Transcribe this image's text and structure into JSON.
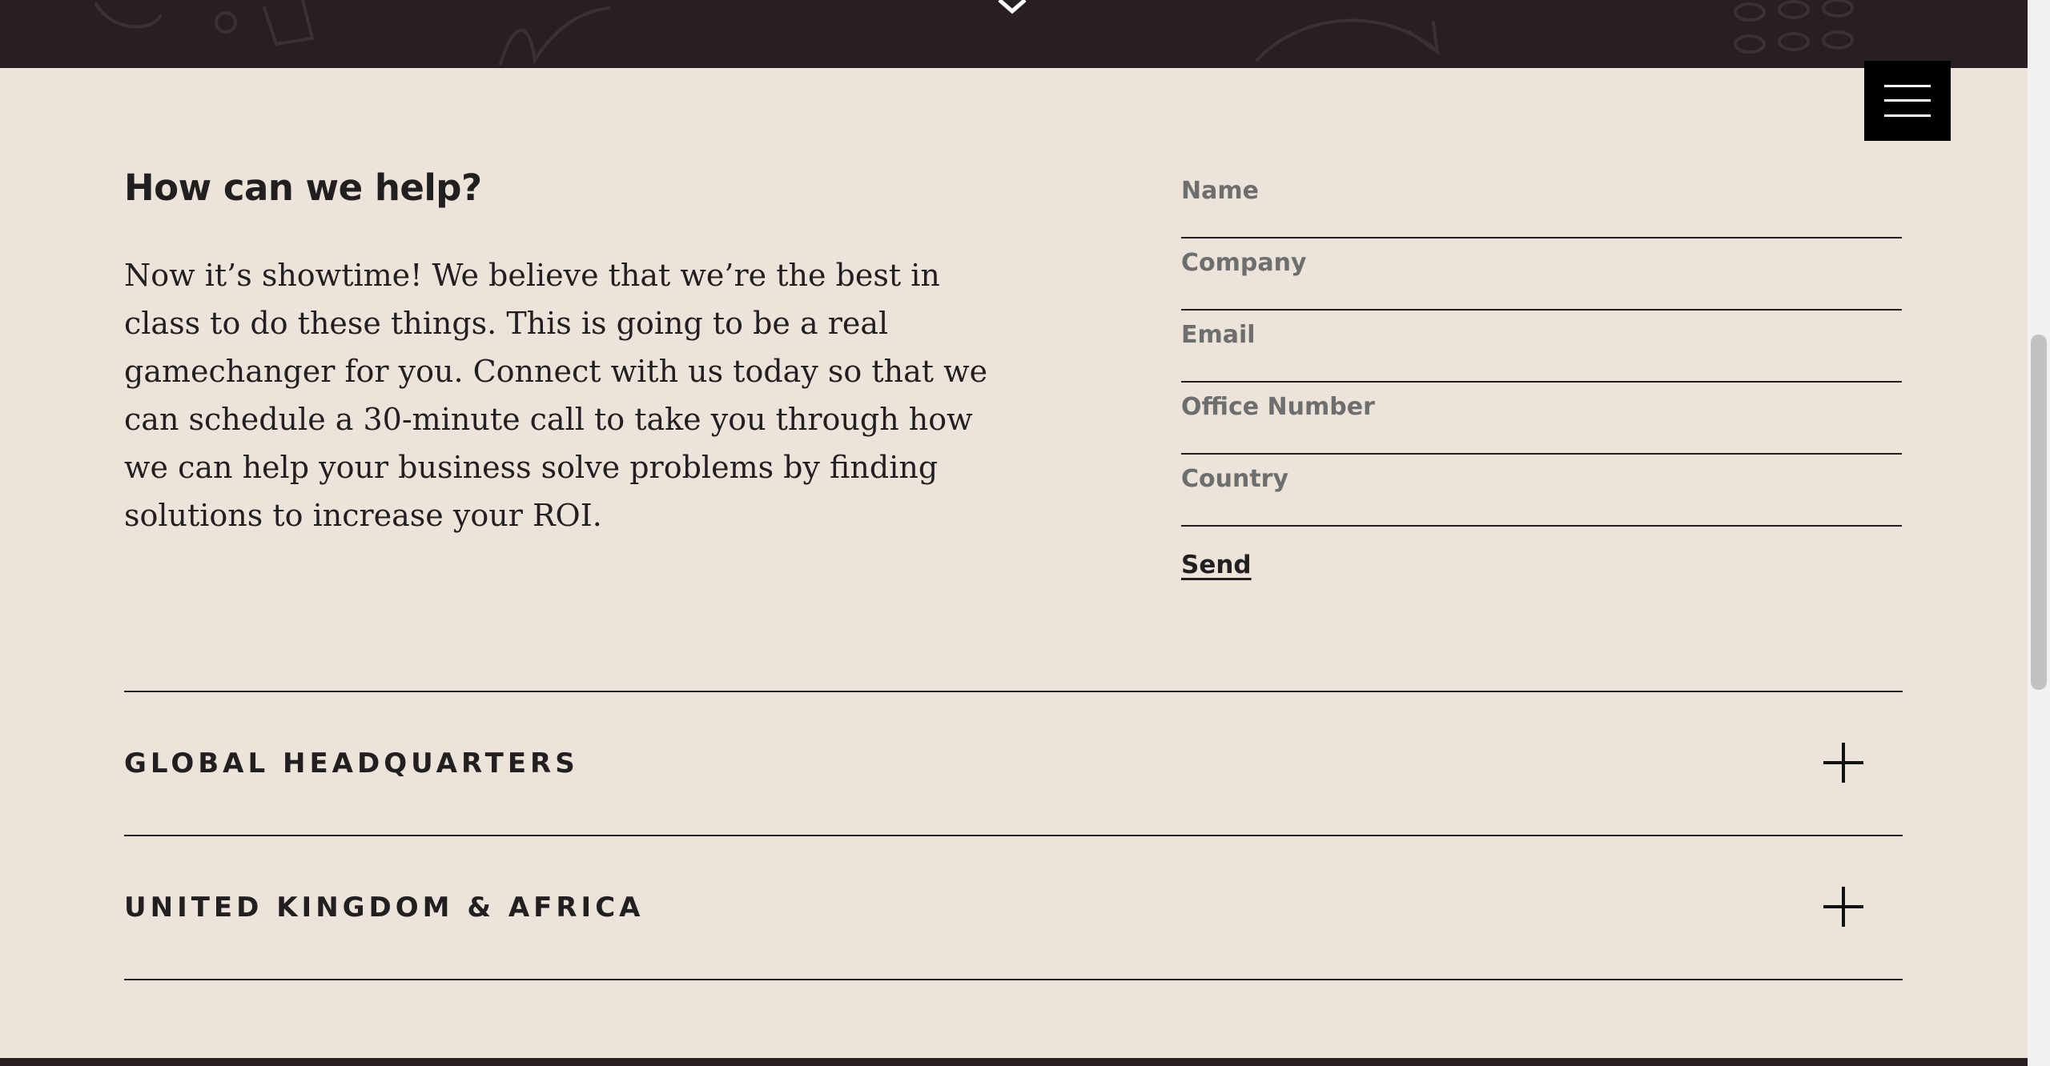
{
  "contact": {
    "heading": "How can we help?",
    "body": "Now it’s showtime! We believe that we’re the best in class to do these things. This is going to be a real gamechanger for you. Connect with us today so that we can schedule a 30-minute call to take you through how we can help your business solve problems by finding solutions to increase your ROI."
  },
  "form": {
    "fields": [
      {
        "placeholder": "Name",
        "value": ""
      },
      {
        "placeholder": "Company",
        "value": ""
      },
      {
        "placeholder": "Email",
        "value": ""
      },
      {
        "placeholder": "Office Number",
        "value": ""
      },
      {
        "placeholder": "Country",
        "value": ""
      }
    ],
    "send_label": "Send"
  },
  "offices": [
    {
      "label": "GLOBAL HEADQUARTERS",
      "icon": "plus-icon"
    },
    {
      "label": "UNITED KINGDOM & AFRICA",
      "icon": "plus-icon"
    }
  ],
  "header": {
    "menu_icon": "hamburger-menu-icon",
    "scroll_icon": "chevron-down-icon"
  },
  "colors": {
    "background": "#ece3da",
    "dark_band": "#271f21",
    "text": "#231f20",
    "placeholder": "#6e6e6e",
    "menu_button": "#000000"
  }
}
